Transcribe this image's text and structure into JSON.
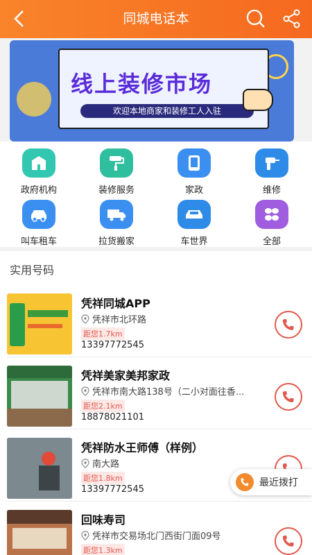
{
  "header": {
    "title": "同城电话本",
    "back_icon": "chevron-left-icon",
    "search_icon": "search-icon",
    "share_icon": "share-icon"
  },
  "banner": {
    "headline": "线上装修市场",
    "subline": "欢迎本地商家和装修工人入驻"
  },
  "categories": [
    {
      "label": "政府机构",
      "icon": "building-icon",
      "color": "#32c7b1"
    },
    {
      "label": "装修服务",
      "icon": "paint-roller-icon",
      "color": "#2fbf9f"
    },
    {
      "label": "家政",
      "icon": "tablet-icon",
      "color": "#3b8ff0"
    },
    {
      "label": "维修",
      "icon": "drill-icon",
      "color": "#2e8be8"
    },
    {
      "label": "叫车租车",
      "icon": "taxi-icon",
      "color": "#3b8ff0"
    },
    {
      "label": "拉货搬家",
      "icon": "truck-icon",
      "color": "#3b8ff0"
    },
    {
      "label": "车世界",
      "icon": "car-icon",
      "color": "#2e8be8"
    },
    {
      "label": "全部",
      "icon": "grid-icon",
      "color": "#a05de0"
    }
  ],
  "section": {
    "title": "实用号码"
  },
  "listings": [
    {
      "name": "凭祥同城APP",
      "address": "凭祥市北环路",
      "distance": "距您1.7km",
      "phone": "13397772545",
      "thumb_color": "#f7c534"
    },
    {
      "name": "凭祥美家美邦家政",
      "address": "凭祥市南大路138号（二小对面往香...",
      "distance": "距您2.1km",
      "phone": "18878021101",
      "thumb_color": "#3a8a4a"
    },
    {
      "name": "凭祥防水王师傅（样例）",
      "address": "南大路",
      "distance": "距您1.8km",
      "phone": "13397772545",
      "thumb_color": "#6f7b84"
    },
    {
      "name": "回味寿司",
      "address": "凭祥市交易场北门西街门面09号",
      "distance": "距您1.3km",
      "phone": "",
      "thumb_color": "#b9734a"
    }
  ],
  "floating": {
    "label": "最近拨打",
    "icon": "phone-icon"
  },
  "colors": {
    "accent": "#f5691f",
    "call": "#e2574c"
  }
}
